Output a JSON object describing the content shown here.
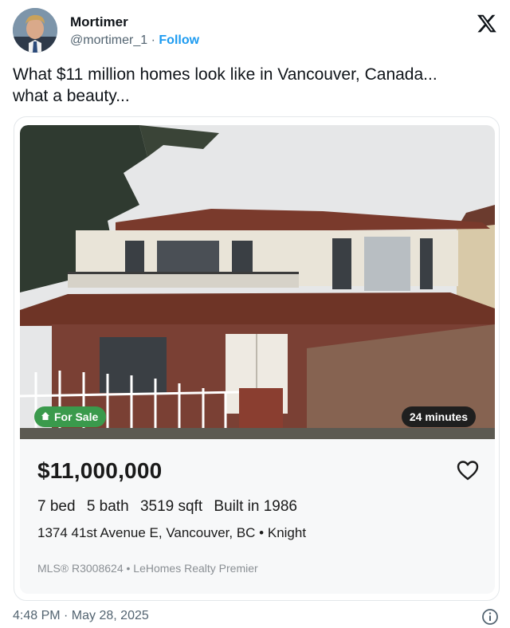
{
  "author": {
    "name": "Mortimer",
    "handle": "@mortimer_1",
    "separator": "·",
    "follow_label": "Follow",
    "avatar_icon": "profile-photo"
  },
  "platform_icon": "x-logo-icon",
  "tweet": {
    "line1": "What $11 million homes look like in Vancouver, Canada...",
    "line2": "what a beauty..."
  },
  "listing": {
    "status_badge": "For Sale",
    "status_icon": "home-icon",
    "time_badge": "24 minutes",
    "price": "$11,000,000",
    "beds": "7 bed",
    "baths": "5 bath",
    "sqft": "3519 sqft",
    "built": "Built in 1986",
    "address": "1374 41st Avenue E, Vancouver, BC • Knight",
    "mls": "MLS® R3008624 • LeHomes Realty Premier",
    "favorite_icon": "heart-icon"
  },
  "footer": {
    "timestamp": "4:48 PM · May 28, 2025",
    "info_icon": "info-icon"
  },
  "colors": {
    "follow_link": "#1d9bf0",
    "for_sale_badge": "#3a9a4c",
    "time_badge": "#1f1f1f",
    "muted_text": "#536471"
  }
}
